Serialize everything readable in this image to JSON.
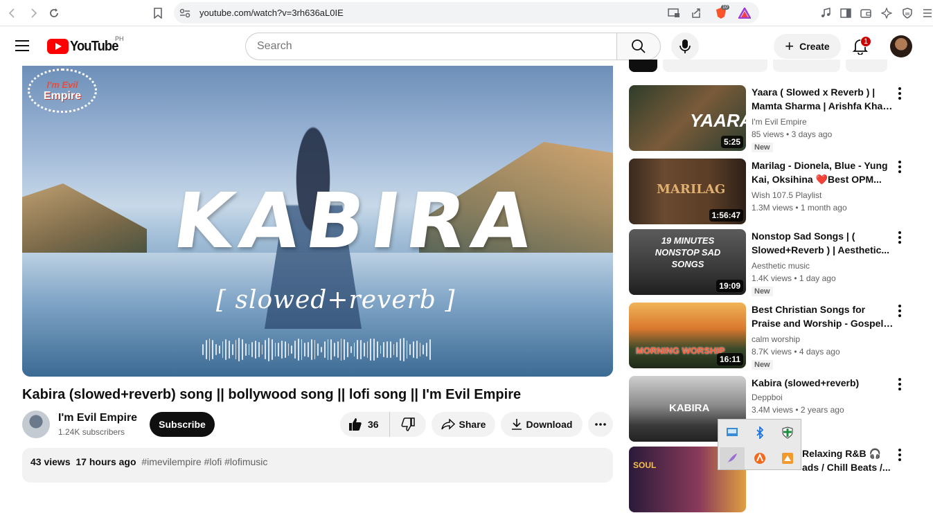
{
  "browser": {
    "url": "youtube.com/watch?v=3rh636aL0IE",
    "brave_badge": "10"
  },
  "header": {
    "logo_text": "YouTube",
    "country_code": "PH",
    "search_placeholder": "Search",
    "create_label": "Create",
    "notification_count": "1"
  },
  "video": {
    "overlay_title": "KABIRA",
    "overlay_subtitle": "[ slowed+reverb ]",
    "overlay_brand_line1": "I'm Evil",
    "overlay_brand_line2": "Empire",
    "title": "Kabira (slowed+reverb) song || bollywood song || lofi song || I'm Evil Empire",
    "channel": "I'm Evil Empire",
    "subscribers": "1.24K subscribers",
    "subscribe_label": "Subscribe",
    "likes": "36",
    "share_label": "Share",
    "download_label": "Download",
    "views": "43 views",
    "age": "17 hours ago",
    "tags": "#imevilempire #lofi #lofimusic"
  },
  "recommendations": [
    {
      "title": "Yaara ( Slowed x Reverb ) | Mamta Sharma | Arishfa Khan ...",
      "channel": "I'm Evil Empire",
      "views": "85 views",
      "age": "3 days ago",
      "duration": "5:25",
      "badge": "New",
      "thumb_text": "YAARA"
    },
    {
      "title": "Marilag - Dionela, Blue - Yung Kai, Oksihina ❤️Best OPM...",
      "channel": "Wish 107.5 Playlist",
      "views": "1.3M views",
      "age": "1 month ago",
      "duration": "1:56:47",
      "badge": "",
      "thumb_text": "MARILAG"
    },
    {
      "title": "Nonstop Sad Songs | ( Slowed+Reverb ) | Aesthetic...",
      "channel": "Aesthetic music",
      "views": "1.4K views",
      "age": "1 day ago",
      "duration": "19:09",
      "badge": "New",
      "thumb_text": "19 MINUTES NONSTOP SAD SONGS"
    },
    {
      "title": "Best Christian Songs for Praise and Worship - Gospel Worship...",
      "channel": "calm worship",
      "views": "8.7K views",
      "age": "4 days ago",
      "duration": "16:11",
      "badge": "New",
      "thumb_text": "MORNING WORSHIP"
    },
    {
      "title": "Kabira (slowed+reverb)",
      "channel": "Deppboi",
      "views": "3.4M views",
      "age": "2 years ago",
      "duration": "",
      "badge": "",
      "thumb_text": "KABIRA"
    },
    {
      "title": "Relaxing R&B 🎧",
      "title_line2": "ads / Chill Beats /...",
      "channel": "",
      "views": "",
      "age": "",
      "duration": "",
      "badge": "",
      "thumb_text": "SOUL"
    }
  ],
  "colors": {
    "youtube_red": "#ff0000",
    "subscribe_bg": "#0f0f0f",
    "chip_bg": "#f2f2f2"
  }
}
